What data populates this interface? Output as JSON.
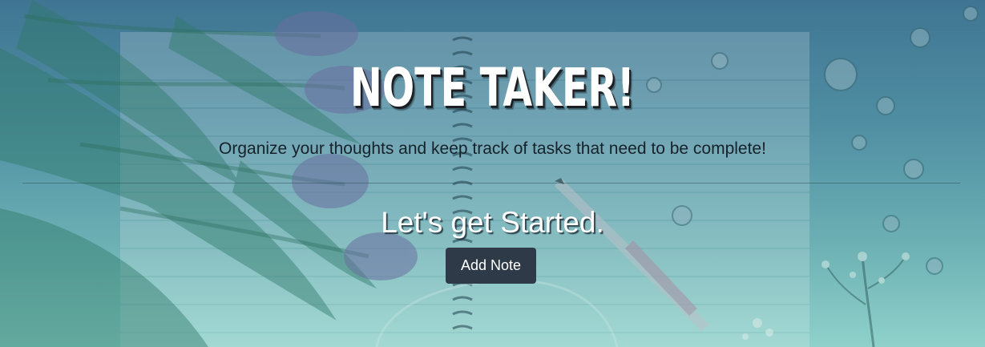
{
  "hero": {
    "title": "NOTE TAKER!",
    "subtitle": "Organize your thoughts and keep track of tasks that need to be complete!",
    "lead": "Let's get Started.",
    "add_note_label": "Add Note"
  },
  "colors": {
    "background_top": "#3f7592",
    "background_bottom": "#8fd1ca",
    "title_text": "#ffffff",
    "subtitle_text": "#16222b",
    "button_background": "#2f3a48",
    "button_text": "#ffffff"
  },
  "background_image": {
    "elements": [
      "tulips",
      "spiral-notebook",
      "pen",
      "buttons",
      "dried-flowers"
    ]
  }
}
